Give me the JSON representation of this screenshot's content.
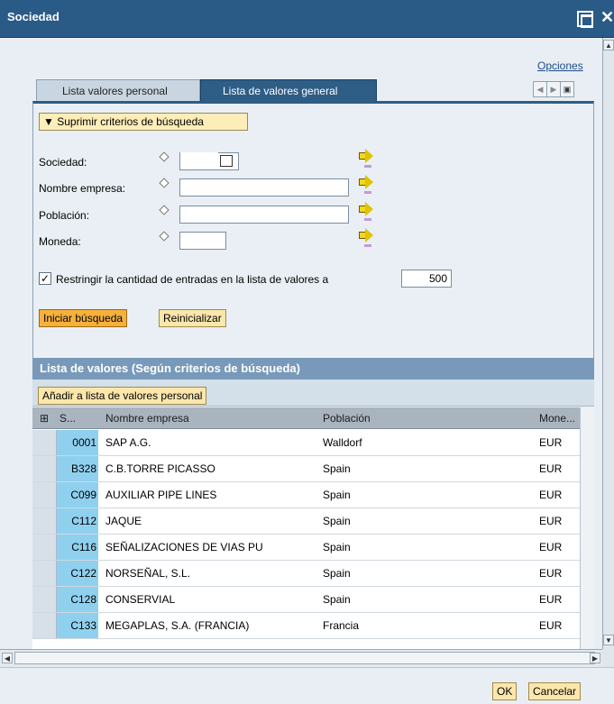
{
  "window": {
    "title": "Sociedad"
  },
  "options_link": "Opciones",
  "tabs": [
    {
      "label": "Lista valores personal"
    },
    {
      "label": "Lista de valores general"
    }
  ],
  "search": {
    "toggle_label": "Suprimir criterios de búsqueda",
    "fields": [
      {
        "label": "Sociedad:",
        "value": ""
      },
      {
        "label": "Nombre empresa:",
        "value": ""
      },
      {
        "label": "Población:",
        "value": ""
      },
      {
        "label": "Moneda:",
        "value": ""
      }
    ],
    "restrict_label": "Restringir la cantidad de entradas en la lista de valores a",
    "restrict_checked": true,
    "restrict_value": "500",
    "start_button": "Iniciar búsqueda",
    "reset_button": "Reinicializar"
  },
  "results": {
    "title": "Lista de valores (Según criterios de búsqueda)",
    "add_button": "Añadir a lista de valores personal",
    "columns": [
      "S...",
      "Nombre empresa",
      "Población",
      "Mone..."
    ],
    "rows": [
      {
        "code": "0001",
        "name": "SAP A.G.",
        "city": "Walldorf",
        "currency": "EUR"
      },
      {
        "code": "B328",
        "name": "C.B.TORRE PICASSO",
        "city": "Spain",
        "currency": "EUR"
      },
      {
        "code": "C099",
        "name": "AUXILIAR PIPE LINES",
        "city": "Spain",
        "currency": "EUR"
      },
      {
        "code": "C112",
        "name": "JAQUE",
        "city": "Spain",
        "currency": "EUR"
      },
      {
        "code": "C116",
        "name": "SEÑALIZACIONES DE VIAS PU",
        "city": "Spain",
        "currency": "EUR"
      },
      {
        "code": "C122",
        "name": "NORSEÑAL, S.L.",
        "city": "Spain",
        "currency": "EUR"
      },
      {
        "code": "C128",
        "name": "CONSERVIAL",
        "city": "Spain",
        "currency": "EUR"
      },
      {
        "code": "C133",
        "name": "MEGAPLAS, S.A. (FRANCIA)",
        "city": "Francia",
        "currency": "EUR"
      }
    ]
  },
  "footer": {
    "ok": "OK",
    "cancel": "Cancelar"
  }
}
